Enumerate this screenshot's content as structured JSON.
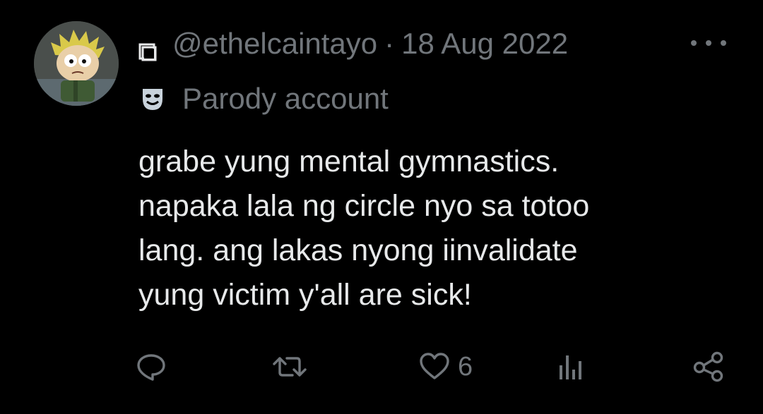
{
  "tweet": {
    "author": {
      "handle": "@ethelcaintayo",
      "avatar_icon": "avatar-cartoon-icon"
    },
    "separator": "·",
    "date": "18 Aug 2022",
    "account_label": "Parody account",
    "account_label_icon": "mask-icon",
    "text_lines": [
      "grabe yung mental gymnastics.",
      "napaka lala ng circle nyo sa totoo",
      "lang. ang lakas nyong iinvalidate",
      "yung victim y'all are sick!"
    ],
    "more_icon": "more-options-icon",
    "actions": {
      "reply": {
        "icon": "reply-icon"
      },
      "retweet": {
        "icon": "retweet-icon"
      },
      "like": {
        "icon": "heart-icon",
        "count": "6"
      },
      "views": {
        "icon": "views-icon"
      },
      "share": {
        "icon": "share-icon"
      }
    }
  },
  "colors": {
    "background": "#000000",
    "text_primary": "#e7e9ea",
    "text_secondary": "#71767b"
  }
}
